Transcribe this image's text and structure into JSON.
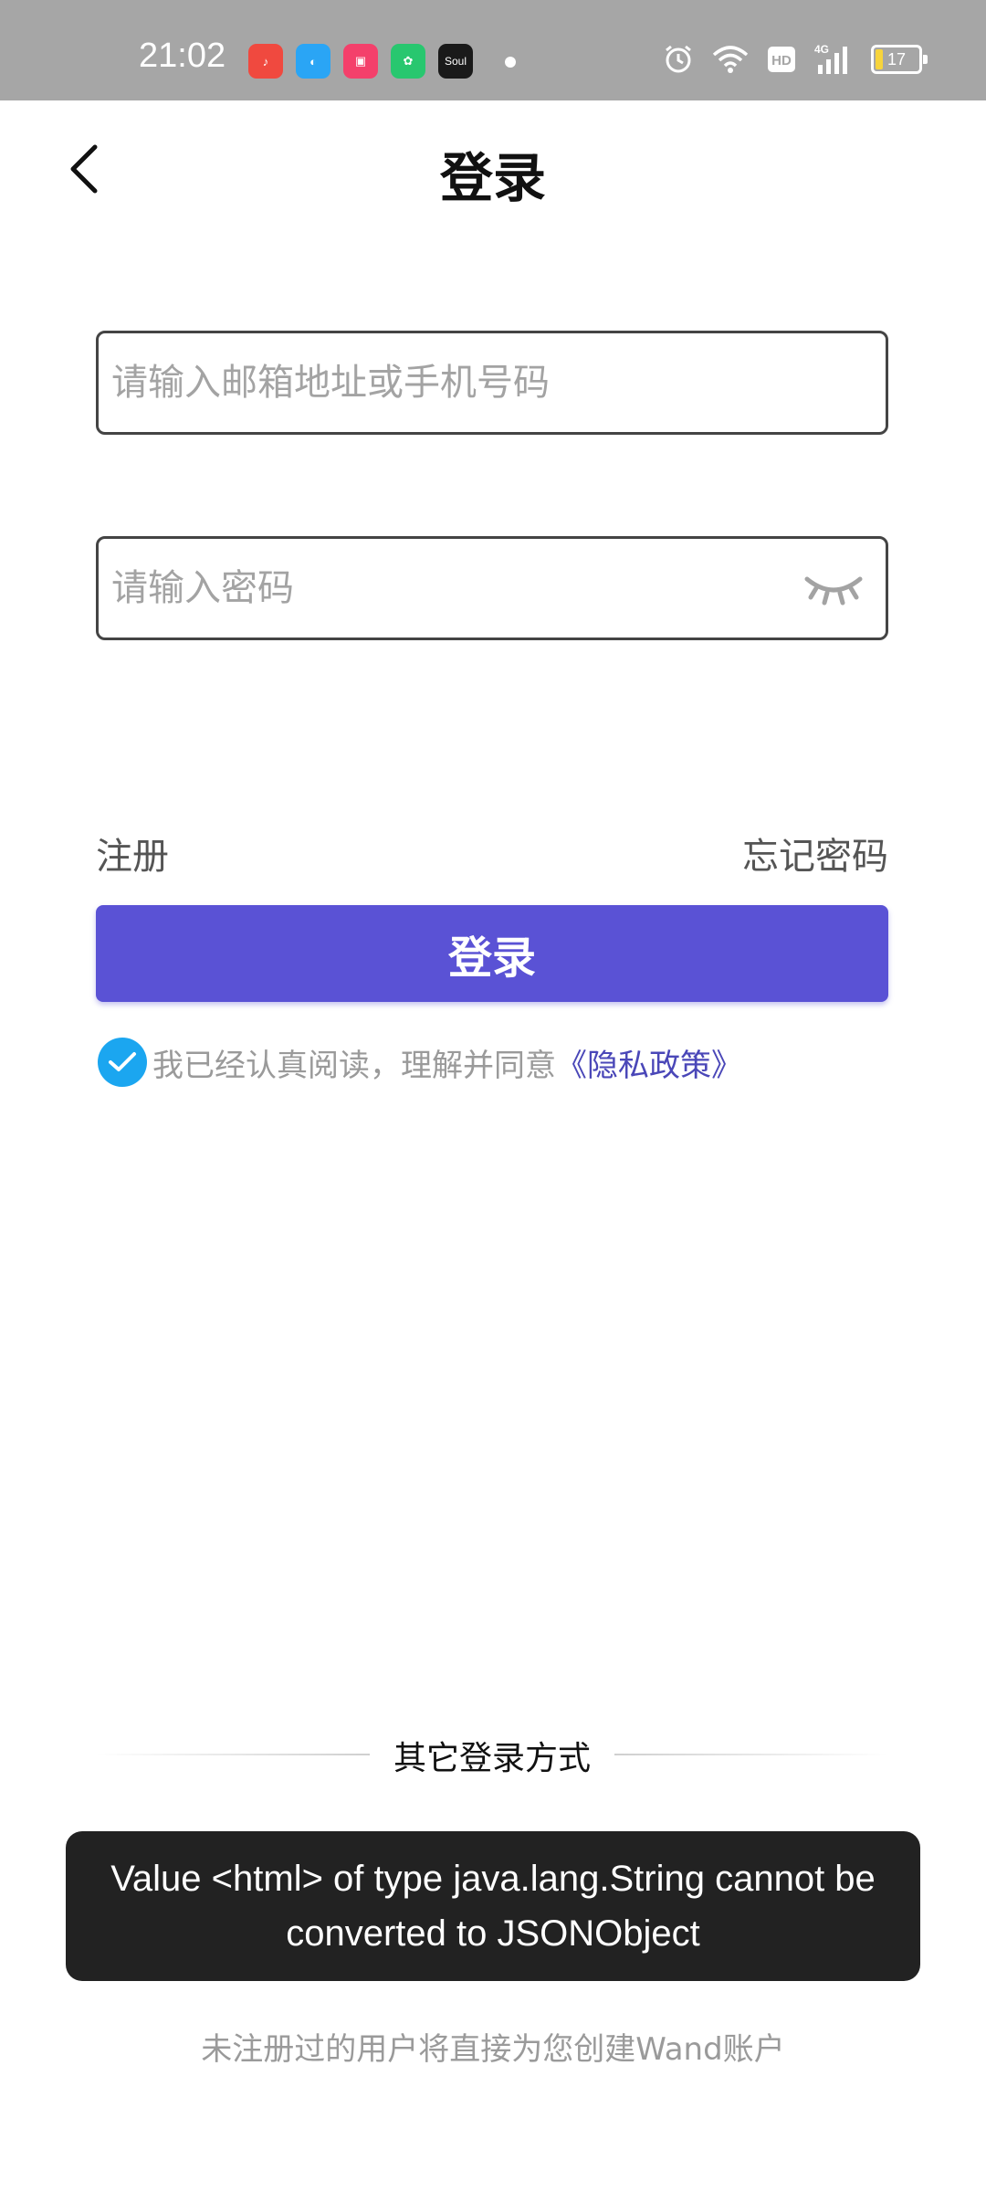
{
  "status_bar": {
    "time": "21:02",
    "apps": [
      {
        "icon": "music-app-icon",
        "color": "#f0493f",
        "glyph": "♪"
      },
      {
        "icon": "browser-app-icon",
        "color": "#2aa5f5",
        "glyph": "◐"
      },
      {
        "icon": "kuaishou-app-icon",
        "color": "#f4406b",
        "glyph": "▣"
      },
      {
        "icon": "green-app-icon",
        "color": "#28c76f",
        "glyph": "✿"
      },
      {
        "icon": "soul-app-icon",
        "color": "#1a1a1a",
        "glyph": "Soul"
      }
    ],
    "network": "4G",
    "battery": "17"
  },
  "header": {
    "title": "登录"
  },
  "form": {
    "account_placeholder": "请输入邮箱地址或手机号码",
    "password_placeholder": "请输入密码"
  },
  "links": {
    "register": "注册",
    "forgot_password": "忘记密码"
  },
  "login_button": "登录",
  "agreement": {
    "text": "我已经认真阅读，理解并同意",
    "link": "《隐私政策》",
    "checked": true
  },
  "other_login": {
    "label": "其它登录方式"
  },
  "toast": {
    "message": "Value <html> of type java.lang.String cannot be converted to JSONObject"
  },
  "footer_note": "未注册过的用户将直接为您创建Wand账户",
  "colors": {
    "primary": "#5a52d5",
    "check": "#1ba6f0",
    "status_bar": "#a6a6a6"
  }
}
